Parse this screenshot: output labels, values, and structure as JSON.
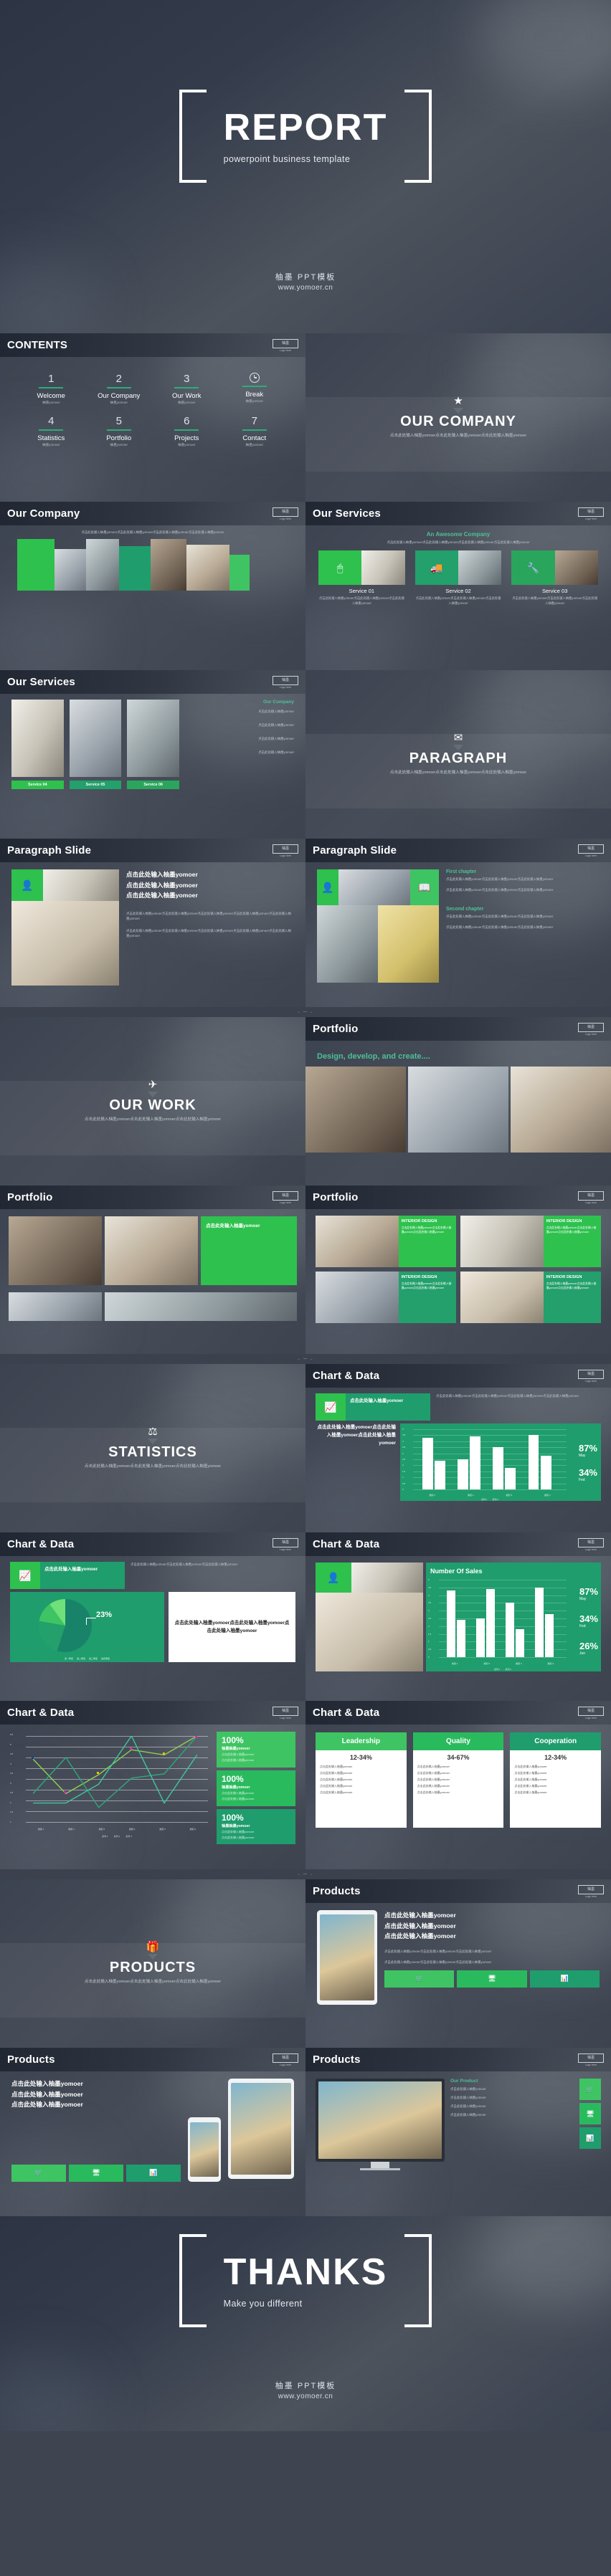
{
  "brand": {
    "cn": "柚墨 PPT模板",
    "url": "www.yomoer.cn"
  },
  "cover": {
    "title": "REPORT",
    "subtitle": "powerpoint business template"
  },
  "ending": {
    "title": "THANKS",
    "subtitle": "Make you different"
  },
  "logo": {
    "mark": "柚墨",
    "caption": "Logo here"
  },
  "placeholder_cn": "点击此处输入柚墨yomoer",
  "lorem_cn": "点击此处输入柚墨yomoer点击此处输入柚墨yomoer点击此处输入柚墨yomoer点击此处输入柚墨yomoer点击此处输入柚墨yomoer",
  "lorem_cn_short": "点击此处输入柚墨yomoer点击此处输入柚墨yomoer点击此处输入柚墨yomoer",
  "contents": {
    "title": "CONTENTS",
    "items": [
      {
        "num": "1",
        "label": "Welcome",
        "sub": "柚墨yomoer",
        "icon": ""
      },
      {
        "num": "2",
        "label": "Our Company",
        "sub": "柚墨yomoer",
        "icon": ""
      },
      {
        "num": "3",
        "label": "Our Work",
        "sub": "柚墨yomoer",
        "icon": ""
      },
      {
        "num": "",
        "label": "Break",
        "sub": "柚墨yomoer",
        "icon": "clock-icon"
      },
      {
        "num": "4",
        "label": "Statistics",
        "sub": "柚墨yomoer",
        "icon": ""
      },
      {
        "num": "5",
        "label": "Portfolio",
        "sub": "柚墨yomoer",
        "icon": ""
      },
      {
        "num": "6",
        "label": "Projects",
        "sub": "柚墨yomoer",
        "icon": ""
      },
      {
        "num": "7",
        "label": "Contact",
        "sub": "柚墨yomoer",
        "icon": ""
      }
    ]
  },
  "dividers": [
    {
      "icon": "★",
      "icon_name": "star-icon",
      "title": "OUR COMPANY",
      "sub": "点击此处输入柚墨yomoer点击此处输入柚墨yomoer点击此处输入柚墨yomoer"
    },
    {
      "icon": "✉",
      "icon_name": "mail-icon",
      "title": "PARAGRAPH",
      "sub": "点击此处输入柚墨yomoer点击此处输入柚墨yomoer点击此处输入柚墨yomoer"
    },
    {
      "icon": "✈",
      "icon_name": "plane-icon",
      "title": "OUR WORK",
      "sub": "点击此处输入柚墨yomoer点击此处输入柚墨yomoer点击此处输入柚墨yomoer"
    },
    {
      "icon": "⚖",
      "icon_name": "scales-icon",
      "title": "STATISTICS",
      "sub": "点击此处输入柚墨yomoer点击此处输入柚墨yomoer点击此处输入柚墨yomoer"
    },
    {
      "icon": "🎁",
      "icon_name": "gift-icon",
      "title": "PRODUCTS",
      "sub": "点击此处输入柚墨yomoer点击此处输入柚墨yomoer点击此处输入柚墨yomoer"
    }
  ],
  "our_company_slide": {
    "title": "Our Company",
    "body": "点击此处输入柚墨yomoer点击此处输入柚墨yomoer点击此处输入柚墨yomoer点击此处输入柚墨yomoer"
  },
  "our_services_1": {
    "title": "Our Services",
    "tagline": "An Awesome Company",
    "body": "点击此处输入柚墨yomoer点击此处输入柚墨yomoer点击此处输入柚墨yomoer点击此处输入柚墨yomoer",
    "services": [
      {
        "name": "Service 01",
        "icon": "🖱",
        "icon_name": "mouse-icon",
        "color": "#2ec14e",
        "text": "点击此处输入柚墨yomoer点击此处输入柚墨yomoer点击此处输入柚墨yomoer"
      },
      {
        "name": "Service 02",
        "icon": "🚚",
        "icon_name": "truck-icon",
        "color": "#23a06b",
        "text": "点击此处输入柚墨yomoer点击此处输入柚墨yomoer点击此处输入柚墨yomoer"
      },
      {
        "name": "Service 03",
        "icon": "🔧",
        "icon_name": "tool-icon",
        "color": "#2aa55c",
        "text": "点击此处输入柚墨yomoer点击此处输入柚墨yomoer点击此处输入柚墨yomoer"
      }
    ]
  },
  "our_services_2": {
    "title": "Our Services",
    "tagline": "Our Company",
    "services": [
      {
        "name": "Service 04",
        "color": "#2ec14e"
      },
      {
        "name": "Service 05",
        "color": "#23a06b"
      },
      {
        "name": "Service 06",
        "color": "#2aa55c"
      }
    ],
    "rows": [
      "点击此处输入柚墨yomoer",
      "点击此处输入柚墨yomoer",
      "点击此处输入柚墨yomoer",
      "点击此处输入柚墨yomoer"
    ]
  },
  "paragraph_1": {
    "title": "Paragraph Slide",
    "icon": "👤",
    "icon_name": "person-icon",
    "lines": [
      "点击此处输入柚墨yomoer",
      "点击此处输入柚墨yomoer",
      "点击此处输入柚墨yomoer"
    ],
    "para1": "点击此处输入柚墨yomoer点击此处输入柚墨yomoer点击此处输入柚墨yomoer点击此处输入柚墨yomoer点击此处输入柚墨yomoer",
    "para2": "点击此处输入柚墨yomoer点击此处输入柚墨yomoer点击此处输入柚墨yomoer点击此处输入柚墨yomoer点击此处输入柚墨yomoer"
  },
  "paragraph_2": {
    "title": "Paragraph Slide",
    "icon1": "👤",
    "icon1_name": "person-icon",
    "icon2": "📖",
    "icon2_name": "book-icon",
    "chapters": [
      {
        "heading": "First chapter",
        "p1": "点击此处输入柚墨yomoer点击此处输入柚墨yomoer点击此处输入柚墨yomoer",
        "p2": "点击此处输入柚墨yomoer点击此处输入柚墨yomoer点击此处输入柚墨yomoer"
      },
      {
        "heading": "Second chapter",
        "p1": "点击此处输入柚墨yomoer点击此处输入柚墨yomoer点击此处输入柚墨yomoer",
        "p2": "点击此处输入柚墨yomoer点击此处输入柚墨yomoer点击此处输入柚墨yomoer"
      }
    ]
  },
  "portfolio_1": {
    "title": "Portfolio",
    "tagline": "Design, develop, and create...."
  },
  "portfolio_2": {
    "title": "Portfolio",
    "caption": "点击此处输入柚墨yomoer",
    "blocks": [
      "点击此处输入柚墨yomoer",
      "点击此处输入柚墨yomoer"
    ]
  },
  "portfolio_3": {
    "title": "Portfolio",
    "tiles": [
      {
        "name": "INTERIOR DESIGN",
        "color": "#2ec14e",
        "text": "点击此处输入柚墨yomoer点击此处输入柚墨yomoer点击此处输入柚墨yomoer"
      },
      {
        "name": "INTERIOR DESIGN",
        "color": "#2ec14e",
        "text": "点击此处输入柚墨yomoer点击此处输入柚墨yomoer点击此处输入柚墨yomoer"
      },
      {
        "name": "INTERIOR DESIGN",
        "color": "#23a06b",
        "text": "点击此处输入柚墨yomoer点击此处输入柚墨yomoer点击此处输入柚墨yomoer"
      },
      {
        "name": "INTERIOR DESIGN",
        "color": "#23a06b",
        "text": "点击此处输入柚墨yomoer点击此处输入柚墨yomoer点击此处输入柚墨yomoer"
      }
    ]
  },
  "chart_data": [
    {
      "type": "bar",
      "slide_title": "Chart & Data",
      "title": "",
      "categories": [
        "类别 1",
        "类别 2",
        "类别 3",
        "类别 4"
      ],
      "series": [
        {
          "name": "系列 1",
          "values": [
            4.3,
            2.5,
            3.5,
            4.5
          ]
        },
        {
          "name": "系列 2",
          "values": [
            2.4,
            4.4,
            1.8,
            2.8
          ]
        }
      ],
      "ylim": [
        0,
        5
      ],
      "yticks": [
        0,
        0.5,
        1,
        1.5,
        2,
        2.5,
        3,
        3.5,
        4,
        4.5,
        5
      ],
      "grid": true,
      "legend": "bottom",
      "kpis": [
        {
          "value": "87%",
          "label": "May"
        },
        {
          "value": "34%",
          "label": "Fed"
        }
      ],
      "panel_heading": "点击此处输入柚墨yomoer",
      "side_text": "点击此处输入柚墨yomoer点击此处输入柚墨yomoer点击此处输入柚墨yomoer点击此处输入柚墨yomoer"
    },
    {
      "type": "pie",
      "slide_title": "Chart & Data",
      "title": "",
      "labels": [
        "第一季度",
        "第二季度",
        "第三季度",
        "第四季度"
      ],
      "values": [
        55,
        23,
        12,
        10
      ],
      "data_label": "23%",
      "colors": [
        "#19836a",
        "#23a06b",
        "#3fc463",
        "#6fe07a"
      ],
      "legend": "bottom",
      "panel_heading": "点击此处输入柚墨yomoer",
      "side_text": "点击此处输入柚墨yomoer点击此处输入柚墨yomoer点击此处输入柚墨yomoer"
    },
    {
      "type": "bar",
      "slide_title": "Chart & Data",
      "title": "Number Of Sales",
      "categories": [
        "类别 1",
        "类别 2",
        "类别 3",
        "类别 4"
      ],
      "series": [
        {
          "name": "系列 1",
          "values": [
            4.3,
            2.5,
            3.5,
            4.5
          ]
        },
        {
          "name": "系列 2",
          "values": [
            2.4,
            4.4,
            1.8,
            2.8
          ]
        }
      ],
      "ylim": [
        0,
        5
      ],
      "yticks": [
        0,
        0.5,
        1,
        1.5,
        2,
        2.5,
        3,
        3.5,
        4,
        4.5,
        5
      ],
      "grid": true,
      "legend": "bottom",
      "kpis": [
        {
          "value": "87%",
          "label": "May"
        },
        {
          "value": "34%",
          "label": "Fed"
        },
        {
          "value": "26%",
          "label": "Jun"
        }
      ]
    },
    {
      "type": "line",
      "slide_title": "Chart & Data",
      "title": "",
      "categories": [
        "类别 1",
        "类别 2",
        "类别 3",
        "类别 4",
        "类别 5",
        "类别 6"
      ],
      "series": [
        {
          "name": "系列 1",
          "values": [
            4.3,
            2.5,
            3.5,
            4.5,
            4.0,
            5.0
          ],
          "color": "#8fd14f"
        },
        {
          "name": "系列 2",
          "values": [
            2.5,
            4.4,
            1.8,
            2.8,
            3.0,
            5.0
          ],
          "color": "#2ea87d"
        },
        {
          "name": "系列 3",
          "values": [
            2.0,
            2.0,
            3.0,
            5.0,
            2.0,
            4.0
          ],
          "color": "#3ec7a0"
        }
      ],
      "ylim": [
        1,
        5.5
      ],
      "yticks": [
        1,
        1.5,
        2,
        2.5,
        3,
        3.5,
        4,
        4.5,
        5,
        5.5
      ],
      "grid": true,
      "legend": "bottom",
      "cards": [
        {
          "value": "100%",
          "title": "柚墨柚墨yomoer",
          "l1": "点击此处输入柚墨yomoer",
          "l2": "点击此处输入柚墨yomoer",
          "color": "#3fc463"
        },
        {
          "value": "100%",
          "title": "柚墨柚墨yomoer",
          "l1": "点击此处输入柚墨yomoer",
          "l2": "点击此处输入柚墨yomoer",
          "color": "#2aba5e"
        },
        {
          "value": "100%",
          "title": "柚墨柚墨yomoer",
          "l1": "点击此处输入柚墨yomoer",
          "l2": "点击此处输入柚墨yomoer",
          "color": "#1f9d6d"
        }
      ]
    },
    {
      "type": "table",
      "slide_title": "Chart & Data",
      "columns": [
        {
          "header": "Leadership",
          "value": "12-34%",
          "color": "#3fc463",
          "rows": [
            "点击此处输入柚墨yomoer",
            "点击此处输入柚墨yomoer",
            "点击此处输入柚墨yomoer",
            "点击此处输入柚墨yomoer",
            "点击此处输入柚墨yomoer"
          ]
        },
        {
          "header": "Quality",
          "value": "34-67%",
          "color": "#2aba5e",
          "rows": [
            "点击此处输入柚墨yomoer",
            "点击此处输入柚墨yomoer",
            "点击此处输入柚墨yomoer",
            "点击此处输入柚墨yomoer",
            "点击此处输入柚墨yomoer"
          ]
        },
        {
          "header": "Cooperation",
          "value": "12-34%",
          "color": "#1f9d6d",
          "rows": [
            "点击此处输入柚墨yomoer",
            "点击此处输入柚墨yomoer",
            "点击此处输入柚墨yomoer",
            "点击此处输入柚墨yomoer",
            "点击此处输入柚墨yomoer"
          ]
        }
      ]
    }
  ],
  "products_1": {
    "title": "Products",
    "lines": [
      "点击此处输入柚墨yomoer",
      "点击此处输入柚墨yomoer",
      "点击此处输入柚墨yomoer"
    ],
    "para1": "点击此处输入柚墨yomoer点击此处输入柚墨yomoer点击此处输入柚墨yomoer",
    "para2": "点击此处输入柚墨yomoer点击此处输入柚墨yomoer点击此处输入柚墨yomoer",
    "buttons": [
      "🛒",
      "🖥",
      "📊"
    ]
  },
  "products_2": {
    "title": "Products",
    "lines": [
      "点击此处输入柚墨yomoer",
      "点击此处输入柚墨yomoer",
      "点击此处输入柚墨yomoer"
    ],
    "buttons": [
      "🛒",
      "🖥",
      "📊"
    ]
  },
  "products_3": {
    "title": "Products",
    "tagline": "Our Product",
    "rows": [
      "点击此处输入柚墨yomoer",
      "点击此处输入柚墨yomoer",
      "点击此处输入柚墨yomoer",
      "点击此处输入柚墨yomoer"
    ],
    "buttons": [
      "🛒",
      "🖥",
      "📊"
    ]
  },
  "separator": "←  —  →"
}
